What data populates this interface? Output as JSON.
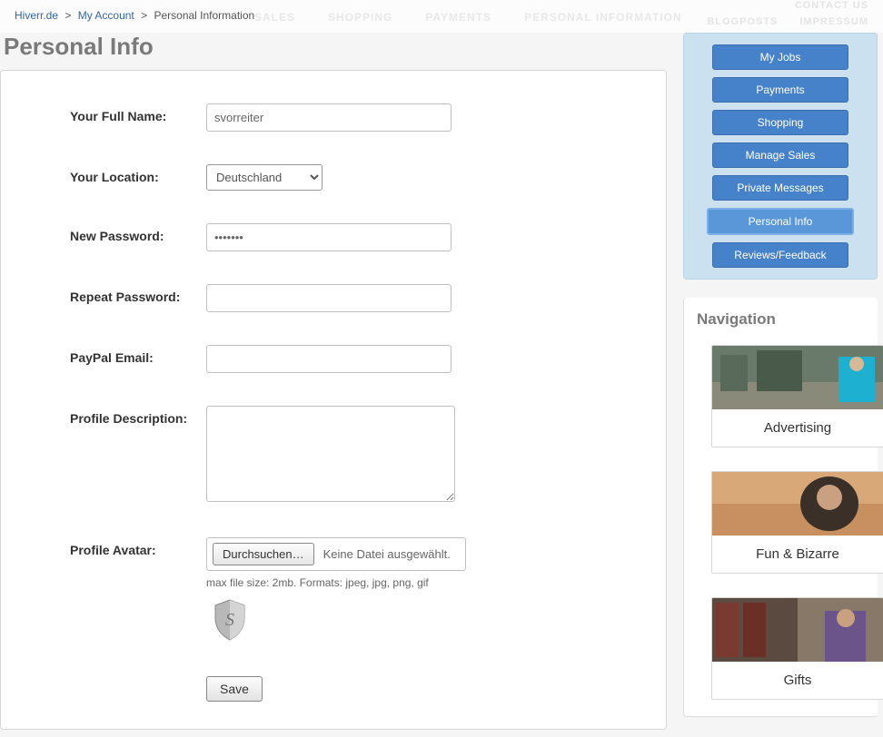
{
  "topnav": {
    "center": [
      "SALES",
      "SHOPPING",
      "PAYMENTS",
      "PERSONAL INFORMATION"
    ],
    "right1": [
      "CONTACT US"
    ],
    "right2": [
      "BLOGPOSTS",
      "IMPRESSUM"
    ]
  },
  "breadcrumb": {
    "a": "Hiverr.de",
    "b": "My Account",
    "c": "Personal Information"
  },
  "page_title": "Personal Info",
  "form": {
    "full_name_label": "Your Full Name:",
    "full_name_value": "svorreiter",
    "location_label": "Your Location:",
    "location_value": "Deutschland",
    "new_password_label": "New Password:",
    "new_password_value": "•••••••",
    "repeat_password_label": "Repeat Password:",
    "repeat_password_value": "",
    "paypal_label": "PayPal Email:",
    "paypal_value": "",
    "profile_desc_label": "Profile Description:",
    "profile_desc_value": "",
    "avatar_label": "Profile Avatar:",
    "file_btn": "Durchsuchen…",
    "file_status": "Keine Datei ausgewählt.",
    "file_hint": "max file size: 2mb. Formats: jpeg, jpg, png, gif",
    "save_label": "Save"
  },
  "quicknav": [
    {
      "label": "My Jobs",
      "active": false
    },
    {
      "label": "Payments",
      "active": false
    },
    {
      "label": "Shopping",
      "active": false
    },
    {
      "label": "Manage Sales",
      "active": false
    },
    {
      "label": "Private Messages",
      "active": false
    },
    {
      "label": "Personal Info",
      "active": true
    },
    {
      "label": "Reviews/Feedback",
      "active": false
    }
  ],
  "nav_title": "Navigation",
  "categories": [
    {
      "label": "Advertising"
    },
    {
      "label": "Fun & Bizarre"
    },
    {
      "label": "Gifts"
    }
  ]
}
